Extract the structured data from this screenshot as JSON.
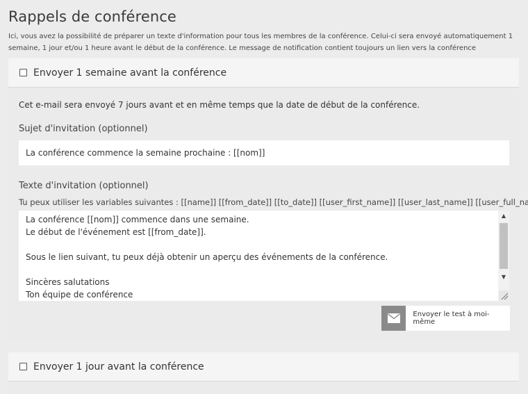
{
  "page": {
    "title": "Rappels de conférence",
    "intro": "Ici, vous avez la possibilité de préparer un texte d'information pour tous les membres de la conférence. Celui-ci sera envoyé automatiquement 1 semaine, 1 jour et/ou 1 heure avant le début de la conférence. Le message de notification contient toujours un lien vers la conférence"
  },
  "week_section": {
    "checkbox_label": "Envoyer 1 semaine avant la conférence",
    "checked": false,
    "description": "Cet e-mail sera envoyé 7 jours avant et en même temps que la date de début de la conférence.",
    "subject_label": "Sujet d'invitation (optionnel)",
    "subject_value": "La conférence commence la semaine prochaine : [[nom]]",
    "text_label": "Texte d'invitation (optionnel)",
    "variables_hint": "Tu peux utiliser les variables suivantes : [[name]] [[from_date]] [[to_date]] [[user_first_name]] [[user_last_name]] [[user_full_name]]",
    "text_lines": [
      "La conférence [[nom]] commence dans une semaine.",
      "Le début de l'événement est [[from_date]].",
      "",
      "Sous le lien suivant, tu peux déjà obtenir un aperçu des événements de la conférence.",
      "",
      "Sincères salutations",
      "Ton équipe de conférence"
    ],
    "test_button_label": "Envoyer le test à moi-même",
    "test_button_icon": "envelope-icon"
  },
  "day_section": {
    "checkbox_label": "Envoyer 1 jour avant la conférence",
    "checked": false
  }
}
